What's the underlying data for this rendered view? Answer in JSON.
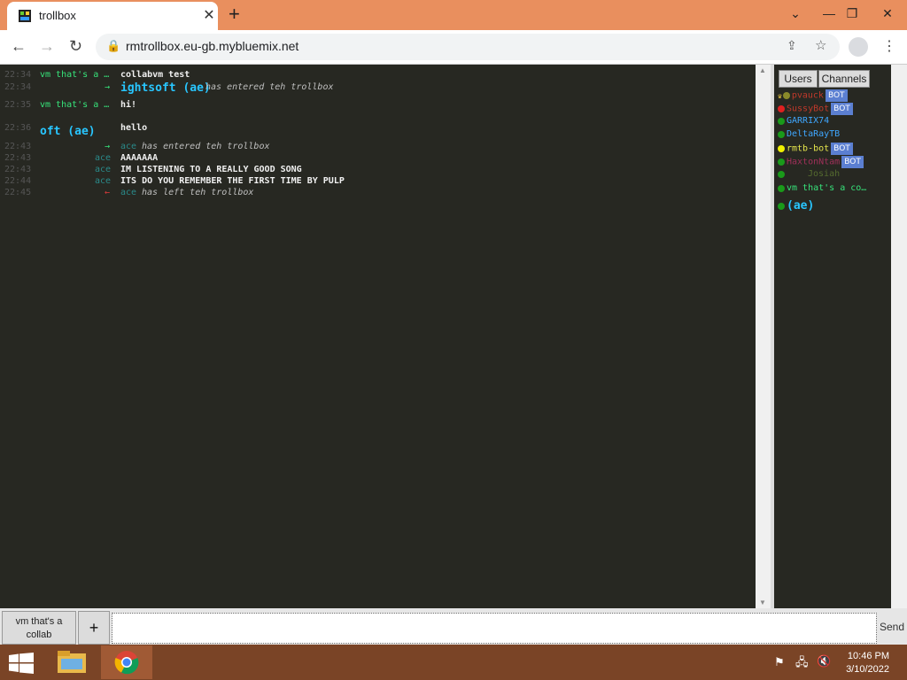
{
  "browser": {
    "tab_title": "trollbox",
    "tab_close": "✕",
    "new_tab": "+",
    "url": "rmtrollbox.eu-gb.mybluemix.net",
    "window_buttons": [
      "⌄",
      "—",
      "❐",
      "✕"
    ]
  },
  "chat": {
    "messages": [
      {
        "time": "22:34",
        "nick": "vm that's a …",
        "nick_color": "#37e37a",
        "text": "collabvm test",
        "kind": "msg"
      },
      {
        "time": "22:34",
        "arrow": "→",
        "nick": "ightsoft (ae)",
        "text": "has entered teh trollbox",
        "kind": "join-big"
      },
      {
        "time": "22:35",
        "nick": "vm that's a …",
        "nick_color": "#37e37a",
        "text": "hi!",
        "kind": "msg"
      },
      {
        "time": "22:36",
        "nick": "oft (ae)",
        "text": "hello",
        "kind": "msg-big"
      },
      {
        "time": "22:43",
        "arrow": "→",
        "nick": "ace",
        "text": "has entered teh trollbox",
        "kind": "join"
      },
      {
        "time": "22:43",
        "nick": "ace",
        "text": "AAAAAAA",
        "kind": "msg-r"
      },
      {
        "time": "22:43",
        "nick": "ace",
        "text": "IM LISTENING TO A REALLY GOOD SONG",
        "kind": "msg-r"
      },
      {
        "time": "22:44",
        "nick": "ace",
        "text": "ITS DO YOU REMEMBER THE FIRST TIME BY PULP",
        "kind": "msg-r"
      },
      {
        "time": "22:45",
        "arrow": "←",
        "nick": "ace",
        "text": "has left teh trollbox",
        "kind": "leave"
      }
    ]
  },
  "sidebar": {
    "tabs": [
      "Users",
      "Channels"
    ],
    "users": [
      {
        "name": "pvauck",
        "color": "#c0392b",
        "dot": "#8a8a2a",
        "crown": true,
        "bot": "BOT"
      },
      {
        "name": "SussyBot",
        "color": "#c0392b",
        "dot": "#e02020",
        "bot": "BOT"
      },
      {
        "name": "GARRIX74",
        "color": "#3fa7ff",
        "dot": "#1a9a1a"
      },
      {
        "name": "DeltaRayTB",
        "color": "#3fa7ff",
        "dot": "#1a9a1a"
      },
      {
        "name": "rmtb-bot",
        "color": "#e6e64c",
        "dot": "#f0f000",
        "bot": "BOT"
      },
      {
        "name": "HaxtonNtam",
        "color": "#a0305a",
        "dot": "#1a9a1a",
        "bot": "BOT"
      },
      {
        "name": "Josiah",
        "color": "#556b2f",
        "dot": "#1a9a1a"
      },
      {
        "name": "vm that's a co…",
        "color": "#37e37a",
        "dot": "#1a9a1a"
      },
      {
        "name": "(ae)",
        "color": "#28c6ff",
        "dot": "#1a9a1a",
        "big": true
      }
    ]
  },
  "input": {
    "channel_label": "vm that's a collab",
    "plus": "+",
    "send": "Send",
    "placeholder": ""
  },
  "taskbar": {
    "time": "10:46 PM",
    "date": "3/10/2022"
  }
}
